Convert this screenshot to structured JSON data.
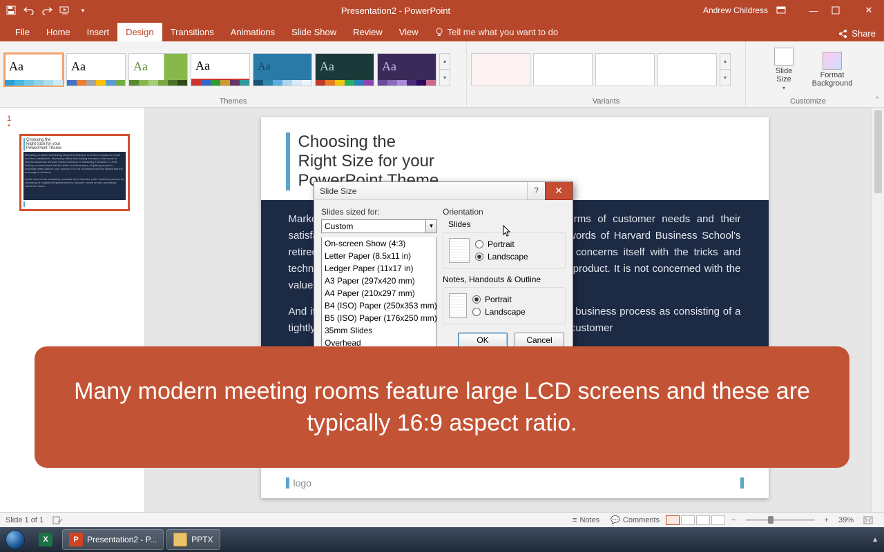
{
  "titlebar": {
    "app_title": "Presentation2 - PowerPoint",
    "user_name": "Andrew Childress"
  },
  "ribbon": {
    "tabs": [
      "File",
      "Home",
      "Insert",
      "Design",
      "Transitions",
      "Animations",
      "Slide Show",
      "Review",
      "View"
    ],
    "active_tab": "Design",
    "tell_me": "Tell me what you want to do",
    "share": "Share",
    "groups": {
      "themes": "Themes",
      "variants": "Variants",
      "customize": "Customize"
    },
    "slide_size": "Slide\nSize",
    "format_bg": "Format\nBackground"
  },
  "slidepanel": {
    "slide_number": "1",
    "star": "*"
  },
  "slide": {
    "title": "Choosing the\nRight Size for your\nPowerPoint Theme",
    "para1": "Marketing is based on thinking about the business in terms of customer needs and their satisfaction. Marketing differs from selling because (in the words of Harvard Business School's retired professor of marketing Theodore C. Levitt) \"Selling concerns itself with the tricks and techniques of getting people to exchange their cash for your product. It is not concerned with the values that the exchange is all about.",
    "para2": "And it does not, as marketing invariable does, view the entire business process as consisting of a tightly integrated effort to discover, create, arouse and satisfy customer",
    "footer_left": "logo",
    "footer_right": " "
  },
  "dialog": {
    "title": "Slide Size",
    "sized_for_label": "Slides sized for:",
    "sized_for_value": "Custom",
    "options": [
      "On-screen Show (4:3)",
      "Letter Paper (8.5x11 in)",
      "Ledger Paper (11x17 in)",
      "A3 Paper (297x420 mm)",
      "A4 Paper (210x297 mm)",
      "B4 (ISO) Paper (250x353 mm)",
      "B5 (ISO) Paper (176x250 mm)",
      "35mm Slides",
      "Overhead"
    ],
    "orientation_label": "Orientation",
    "slides_label": "Slides",
    "notes_label": "Notes, Handouts & Outline",
    "portrait": "Portrait",
    "landscape": "Landscape",
    "ok": "OK",
    "cancel": "Cancel"
  },
  "annotation": {
    "text": "Many modern meeting rooms feature large LCD screens and these are typically 16:9 aspect ratio."
  },
  "status": {
    "slide_info": "Slide 1 of 1",
    "notes": "Notes",
    "comments": "Comments",
    "zoom_pct": "39%"
  },
  "taskbar": {
    "items": [
      "",
      "Presentation2 - P...",
      "PPTX"
    ]
  }
}
